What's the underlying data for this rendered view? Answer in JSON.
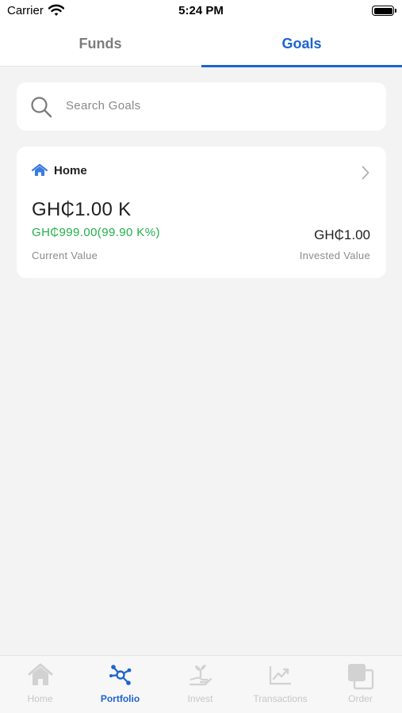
{
  "status_bar": {
    "carrier": "Carrier",
    "time": "5:24 PM",
    "battery_level": 1.0
  },
  "tabs": [
    {
      "label": "Funds",
      "active": false
    },
    {
      "label": "Goals",
      "active": true
    }
  ],
  "search": {
    "placeholder": "Search Goals",
    "icon": "search-icon"
  },
  "goal_card": {
    "icon": "home-icon",
    "name": "Home",
    "current_value": "GH₵1.00 K",
    "gain": "GH₵999.00(99.90 K%)",
    "invested_value": "GH₵1.00",
    "current_value_label": "Current Value",
    "invested_value_label": "Invested Value"
  },
  "bottom_nav": [
    {
      "label": "Home",
      "icon": "home-icon",
      "active": false
    },
    {
      "label": "Portfolio",
      "icon": "portfolio-icon",
      "active": true
    },
    {
      "label": "Invest",
      "icon": "invest-icon",
      "active": false
    },
    {
      "label": "Transactions",
      "icon": "transactions-icon",
      "active": false
    },
    {
      "label": "Order",
      "icon": "order-icon",
      "active": false
    }
  ],
  "colors": {
    "accent": "#1e63d0",
    "gain": "#22b04b",
    "background": "#f3f3f3",
    "inactive": "#c7c7c7"
  }
}
